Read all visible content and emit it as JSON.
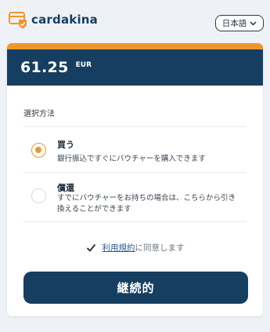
{
  "brand": {
    "name": "cardakina"
  },
  "language": {
    "selected": "日本語"
  },
  "payment": {
    "amount": "61.25",
    "currency": "EUR"
  },
  "method": {
    "section_label": "選択方法",
    "options": [
      {
        "title": "買う",
        "description": "銀行振込ですぐにバウチャーを購入できます",
        "selected": true
      },
      {
        "title": "償還",
        "description": "すでにバウチャーをお持ちの場合は、こちらから引き換えることができます",
        "selected": false
      }
    ]
  },
  "terms": {
    "link_text": "利用規約",
    "suffix": "に同意します",
    "checked": true
  },
  "actions": {
    "continue_label": "継続的"
  },
  "colors": {
    "primary": "#163e61",
    "accent": "#f0962f"
  },
  "icons": {
    "logo": "cardakina-card-logo",
    "language_dropdown": "chevron-down-icon",
    "terms_checkbox": "checkmark-icon"
  }
}
